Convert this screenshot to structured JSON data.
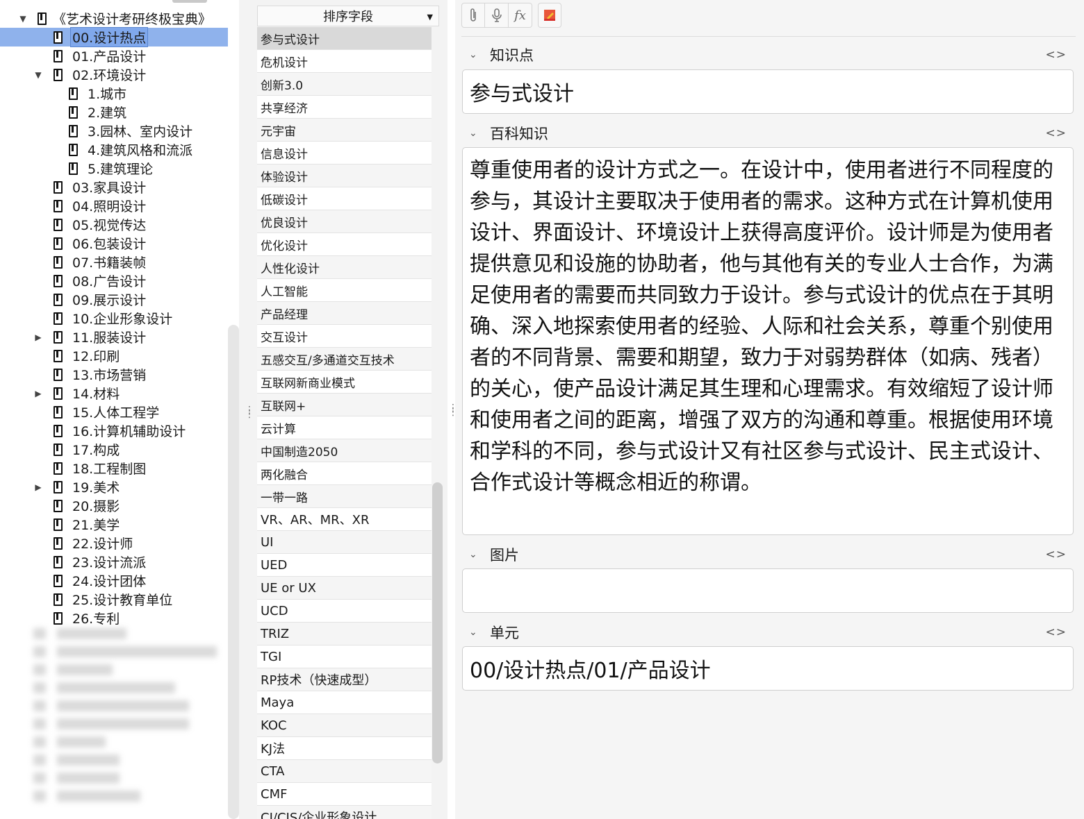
{
  "tree": {
    "items": [
      {
        "label": "《艺术设计考研终极宝典》",
        "level": 0,
        "arrow": "expanded"
      },
      {
        "label": "00.设计热点",
        "level": 1,
        "arrow": "none",
        "selected": true
      },
      {
        "label": "01.产品设计",
        "level": 1,
        "arrow": "none"
      },
      {
        "label": "02.环境设计",
        "level": 1,
        "arrow": "expanded"
      },
      {
        "label": "1.城市",
        "level": 2,
        "arrow": "none"
      },
      {
        "label": "2.建筑",
        "level": 2,
        "arrow": "none"
      },
      {
        "label": "3.园林、室内设计",
        "level": 2,
        "arrow": "none"
      },
      {
        "label": "4.建筑风格和流派",
        "level": 2,
        "arrow": "none"
      },
      {
        "label": "5.建筑理论",
        "level": 2,
        "arrow": "none"
      },
      {
        "label": "03.家具设计",
        "level": 1,
        "arrow": "none"
      },
      {
        "label": "04.照明设计",
        "level": 1,
        "arrow": "none"
      },
      {
        "label": "05.视觉传达",
        "level": 1,
        "arrow": "none"
      },
      {
        "label": "06.包装设计",
        "level": 1,
        "arrow": "none"
      },
      {
        "label": "07.书籍装帧",
        "level": 1,
        "arrow": "none"
      },
      {
        "label": "08.广告设计",
        "level": 1,
        "arrow": "none"
      },
      {
        "label": "09.展示设计",
        "level": 1,
        "arrow": "none"
      },
      {
        "label": "10.企业形象设计",
        "level": 1,
        "arrow": "none"
      },
      {
        "label": "11.服装设计",
        "level": 1,
        "arrow": "collapsed"
      },
      {
        "label": "12.印刷",
        "level": 1,
        "arrow": "none"
      },
      {
        "label": "13.市场营销",
        "level": 1,
        "arrow": "none"
      },
      {
        "label": "14.材料",
        "level": 1,
        "arrow": "collapsed"
      },
      {
        "label": "15.人体工程学",
        "level": 1,
        "arrow": "none"
      },
      {
        "label": "16.计算机辅助设计",
        "level": 1,
        "arrow": "none"
      },
      {
        "label": "17.构成",
        "level": 1,
        "arrow": "none"
      },
      {
        "label": "18.工程制图",
        "level": 1,
        "arrow": "none"
      },
      {
        "label": "19.美术",
        "level": 1,
        "arrow": "collapsed"
      },
      {
        "label": "20.摄影",
        "level": 1,
        "arrow": "none"
      },
      {
        "label": "21.美学",
        "level": 1,
        "arrow": "none"
      },
      {
        "label": "22.设计师",
        "level": 1,
        "arrow": "none"
      },
      {
        "label": "23.设计流派",
        "level": 1,
        "arrow": "none"
      },
      {
        "label": "24.设计团体",
        "level": 1,
        "arrow": "none"
      },
      {
        "label": "25.设计教育单位",
        "level": 1,
        "arrow": "none"
      },
      {
        "label": "26.专利",
        "level": 1,
        "arrow": "none"
      }
    ]
  },
  "list": {
    "sort_header": "排序字段",
    "items": [
      "参与式设计",
      "危机设计",
      "创新3.0",
      "共享经济",
      "元宇宙",
      "信息设计",
      "体验设计",
      "低碳设计",
      "优良设计",
      "优化设计",
      "人性化设计",
      "人工智能",
      "产品经理",
      "交互设计",
      "五感交互/多通道交互技术",
      "互联网新商业模式",
      "互联网+",
      "云计算",
      "中国制造2050",
      "两化融合",
      "一带一路",
      "VR、AR、MR、XR",
      "UI",
      "UED",
      "UE or UX",
      "UCD",
      "TRIZ",
      "TGI",
      "RP技术（快速成型）",
      "Maya",
      "KOC",
      "KJ法",
      "CTA",
      "CMF",
      "CI/CIS/企业形象设计"
    ]
  },
  "toolbar": {
    "icons": [
      "paperclip-icon",
      "microphone-icon",
      "formula-icon",
      "color-icon"
    ],
    "formula_glyph": "fx"
  },
  "editor": {
    "code_toggle": "<>",
    "fields": {
      "knowledge_point": {
        "label": "知识点",
        "value": "参与式设计"
      },
      "encyclopedia": {
        "label": "百科知识",
        "lines": [
          "尊重使用者的设计方式之一。在设计中，使用者进行不同程度的",
          "参与，其设计主要取决于使用者的需求。这种方式在计算机使用",
          "设计、界面设计、环境设计上获得高度评价。设计师是为使用者",
          "提供意见和设施的协助者，他与其他有关的专业人士合作，为满",
          "足使用者的需要而共同致力于设计。参与式设计的优点在于其明",
          "确、深入地探索使用者的经验、人际和社会关系，尊重个别使用",
          "者的不同背景、需要和期望，致力于对弱势群体（如病、残者）",
          "的关心，使产品设计满足其生理和心理需求。有效缩短了设计师",
          "和使用者之间的距离，增强了双方的沟通和尊重。根据使用环境",
          "和学科的不同，参与式设计又有社区参与式设计、民主式设计、",
          "合作式设计等概念相近的称谓。"
        ]
      },
      "image": {
        "label": "图片",
        "value": ""
      },
      "unit": {
        "label": "单元",
        "value": "00/设计热点/01/产品设计"
      }
    }
  }
}
